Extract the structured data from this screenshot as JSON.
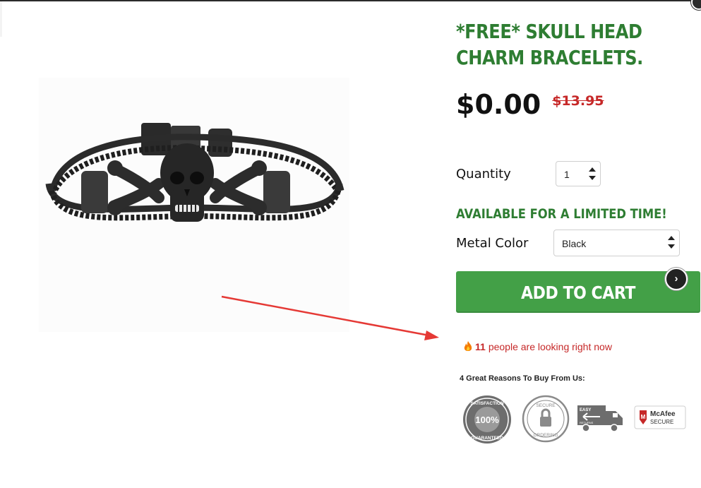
{
  "product": {
    "title": "*FREE* SKULL HEAD CHARM BRACELETS.",
    "image_alt": "skull head charm bracelet"
  },
  "price": {
    "current": "$0.00",
    "original": "$13.95"
  },
  "quantity": {
    "label": "Quantity",
    "value": "1"
  },
  "availability_text": "AVAILABLE FOR A LIMITED TIME!",
  "metal_color": {
    "label": "Metal Color",
    "selected": "Black"
  },
  "cart": {
    "button_label": "ADD TO CART",
    "next_icon": "chevron-right-icon"
  },
  "viewers": {
    "count": "11",
    "text": "people are looking right now",
    "icon": "fire-icon"
  },
  "trust": {
    "heading": "4 Great Reasons To Buy From Us:",
    "badges": [
      {
        "name": "satisfaction-guaranteed-badge",
        "top": "SATISFACTION",
        "main": "100%",
        "bottom": "GUARANTEED"
      },
      {
        "name": "secure-ordering-badge",
        "top": "SECURE",
        "bottom": "ORDERING"
      },
      {
        "name": "easy-returns-badge",
        "text": "EASY",
        "sub": "RETURNS"
      },
      {
        "name": "mcafee-secure-badge",
        "line1": "McAfee",
        "line2": "SECURE"
      }
    ]
  },
  "colors": {
    "brand_green": "#2e7d32",
    "button_green": "#43a047",
    "price_red": "#c62828",
    "annotation_arrow": "#e53935"
  }
}
